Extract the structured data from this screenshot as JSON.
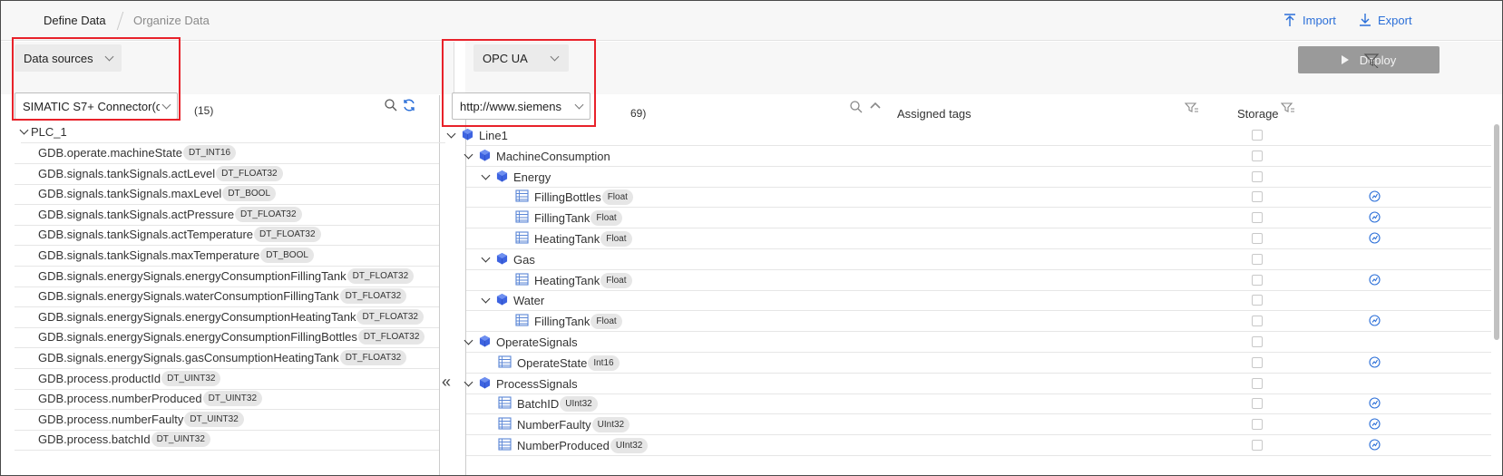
{
  "nav": {
    "tabs": [
      "Define Data",
      "Organize Data"
    ],
    "import_label": "Import",
    "export_label": "Export"
  },
  "left": {
    "datasource_button": "Data sources",
    "connector_select": "SIMATIC S7+ Connector(c",
    "count": "(15)",
    "root_label": "PLC_1",
    "items": [
      {
        "name": "GDB.operate.machineState",
        "type": "DT_INT16"
      },
      {
        "name": "GDB.signals.tankSignals.actLevel",
        "type": "DT_FLOAT32"
      },
      {
        "name": "GDB.signals.tankSignals.maxLevel",
        "type": "DT_BOOL"
      },
      {
        "name": "GDB.signals.tankSignals.actPressure",
        "type": "DT_FLOAT32"
      },
      {
        "name": "GDB.signals.tankSignals.actTemperature",
        "type": "DT_FLOAT32"
      },
      {
        "name": "GDB.signals.tankSignals.maxTemperature",
        "type": "DT_BOOL"
      },
      {
        "name": "GDB.signals.energySignals.energyConsumptionFillingTank",
        "type": "DT_FLOAT32"
      },
      {
        "name": "GDB.signals.energySignals.waterConsumptionFillingTank",
        "type": "DT_FLOAT32"
      },
      {
        "name": "GDB.signals.energySignals.energyConsumptionHeatingTank",
        "type": "DT_FLOAT32"
      },
      {
        "name": "GDB.signals.energySignals.energyConsumptionFillingBottles",
        "type": "DT_FLOAT32"
      },
      {
        "name": "GDB.signals.energySignals.gasConsumptionHeatingTank",
        "type": "DT_FLOAT32"
      },
      {
        "name": "GDB.process.productId",
        "type": "DT_UINT32"
      },
      {
        "name": "GDB.process.numberProduced",
        "type": "DT_UINT32"
      },
      {
        "name": "GDB.process.numberFaulty",
        "type": "DT_UINT32"
      },
      {
        "name": "GDB.process.batchId",
        "type": "DT_UINT32"
      }
    ]
  },
  "right": {
    "protocol_button": "OPC UA",
    "deploy_label": "Deploy",
    "namespace_select": "http://www.siemens",
    "count": "69)",
    "col_assigned": "Assigned tags",
    "col_storage": "Storage",
    "tree": [
      {
        "label": "Line1",
        "kind": "object",
        "level": 0,
        "expanded": true,
        "storage": false
      },
      {
        "label": "MachineConsumption",
        "kind": "object",
        "level": 1,
        "expanded": true,
        "storage": false
      },
      {
        "label": "Energy",
        "kind": "object",
        "level": 2,
        "expanded": true,
        "storage": false
      },
      {
        "label": "FillingBottles",
        "kind": "tag",
        "type": "Float",
        "level": 3,
        "storage": true
      },
      {
        "label": "FillingTank",
        "kind": "tag",
        "type": "Float",
        "level": 3,
        "storage": true
      },
      {
        "label": "HeatingTank",
        "kind": "tag",
        "type": "Float",
        "level": 3,
        "storage": true
      },
      {
        "label": "Gas",
        "kind": "object",
        "level": 2,
        "expanded": true,
        "storage": false
      },
      {
        "label": "HeatingTank",
        "kind": "tag",
        "type": "Float",
        "level": 3,
        "storage": true
      },
      {
        "label": "Water",
        "kind": "object",
        "level": 2,
        "expanded": true,
        "storage": false
      },
      {
        "label": "FillingTank",
        "kind": "tag",
        "type": "Float",
        "level": 3,
        "storage": true
      },
      {
        "label": "OperateSignals",
        "kind": "object",
        "level": 1,
        "expanded": true,
        "storage": false
      },
      {
        "label": "OperateState",
        "kind": "tag",
        "type": "Int16",
        "level": 2,
        "storage": true
      },
      {
        "label": "ProcessSignals",
        "kind": "object",
        "level": 1,
        "expanded": true,
        "storage": false
      },
      {
        "label": "BatchID",
        "kind": "tag",
        "type": "UInt32",
        "level": 2,
        "storage": true
      },
      {
        "label": "NumberFaulty",
        "kind": "tag",
        "type": "UInt32",
        "level": 2,
        "storage": true
      },
      {
        "label": "NumberProduced",
        "kind": "tag",
        "type": "UInt32",
        "level": 2,
        "storage": true
      }
    ]
  },
  "colors": {
    "accent": "#2b6fd8",
    "highlight": "#e8222a",
    "cube": "#3d63e0"
  }
}
